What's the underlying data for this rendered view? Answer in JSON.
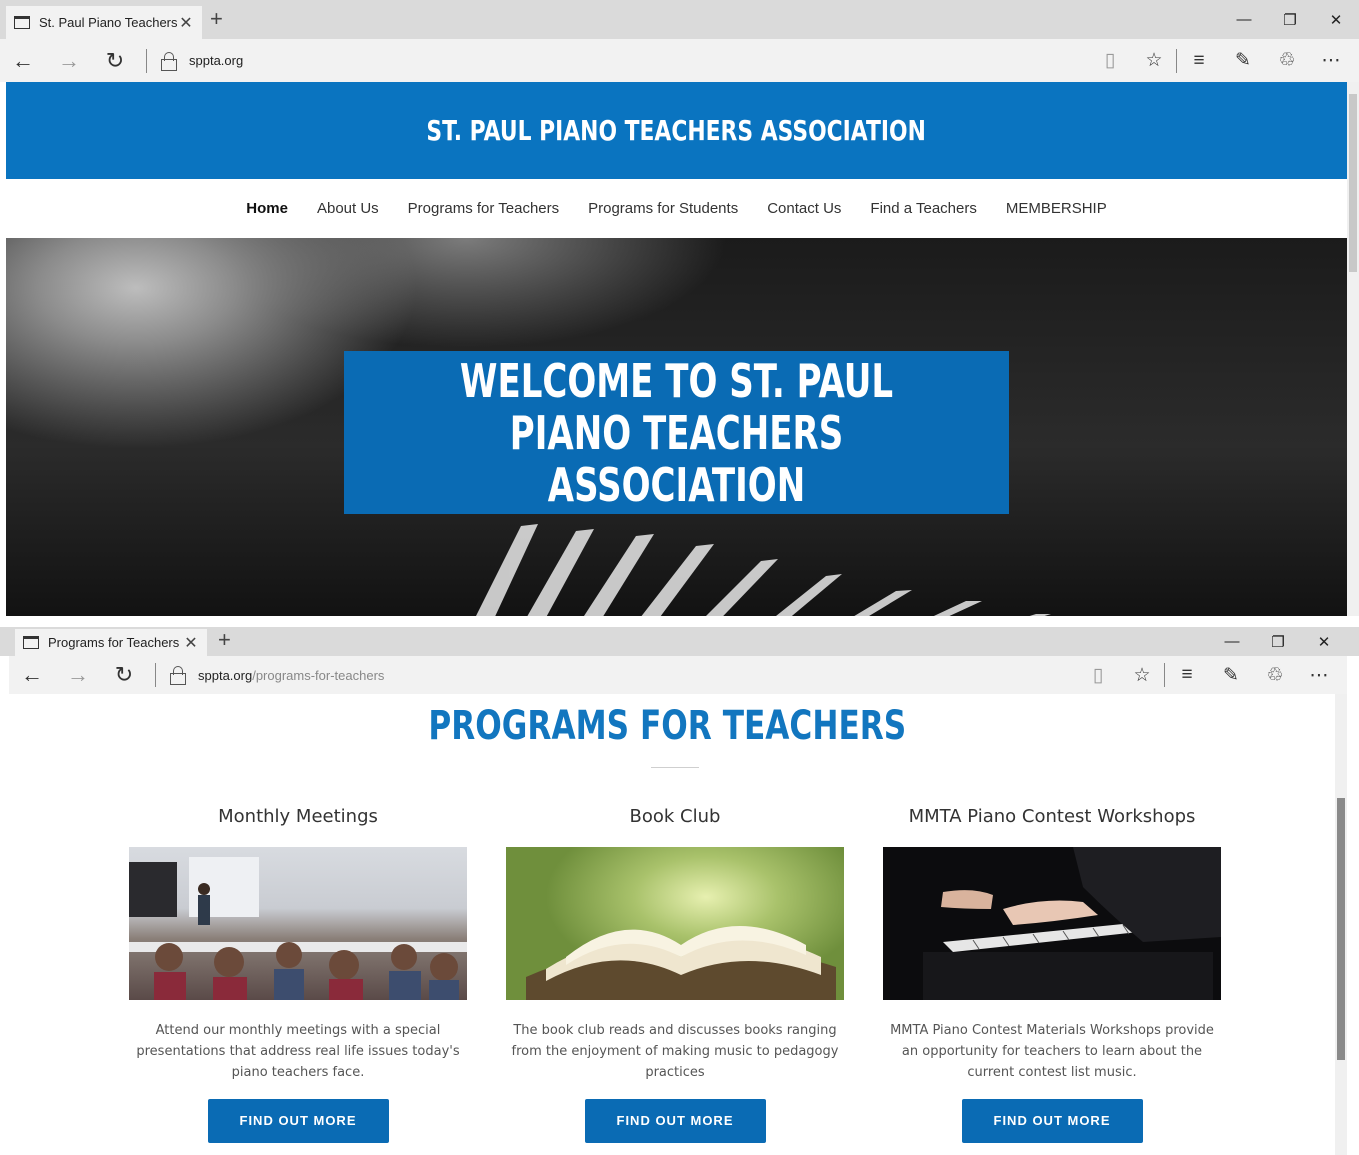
{
  "window1": {
    "tab_title": "St. Paul Piano Teachers ,",
    "url": "sppta.org",
    "url_path": "",
    "site_title": "ST. PAUL PIANO TEACHERS ASSOCIATION",
    "nav": [
      "Home",
      "About Us",
      "Programs for Teachers",
      "Programs for Students",
      "Contact Us",
      "Find a Teachers",
      "MEMBERSHIP"
    ],
    "hero_title": "WELCOME TO ST. PAUL PIANO TEACHERS ASSOCIATION"
  },
  "window2": {
    "tab_title": "Programs for Teachers |",
    "url": "sppta.org",
    "url_path": "/programs-for-teachers",
    "section_title": "PROGRAMS FOR TEACHERS",
    "cards": [
      {
        "title": "Monthly Meetings",
        "text": "Attend our monthly meetings with a special presentations that address real life issues today's piano teachers face.",
        "button": "FIND OUT MORE"
      },
      {
        "title": "Book Club",
        "text": "The book club reads and discusses books ranging from the enjoyment of making music to pedagogy practices",
        "button": "FIND OUT MORE"
      },
      {
        "title": "MMTA Piano Contest Workshops",
        "text": "MMTA Piano Contest Materials Workshops provide an opportunity for teachers to learn about the current contest list music.",
        "button": "FIND OUT MORE"
      }
    ]
  },
  "icons": {
    "tab": "tab-icon",
    "close": "close-icon",
    "new_tab": "plus-icon",
    "back": "back-arrow-icon",
    "forward": "forward-arrow-icon",
    "refresh": "refresh-icon",
    "lock": "lock-icon",
    "reading_view": "book-icon",
    "favorite": "star-icon",
    "hub": "hub-icon",
    "notes": "pen-icon",
    "share": "share-icon",
    "more": "more-icon"
  },
  "colors": {
    "brand_blue": "#0a74c0",
    "button_blue": "#0a6bb4",
    "title_blue": "#1276bf"
  }
}
